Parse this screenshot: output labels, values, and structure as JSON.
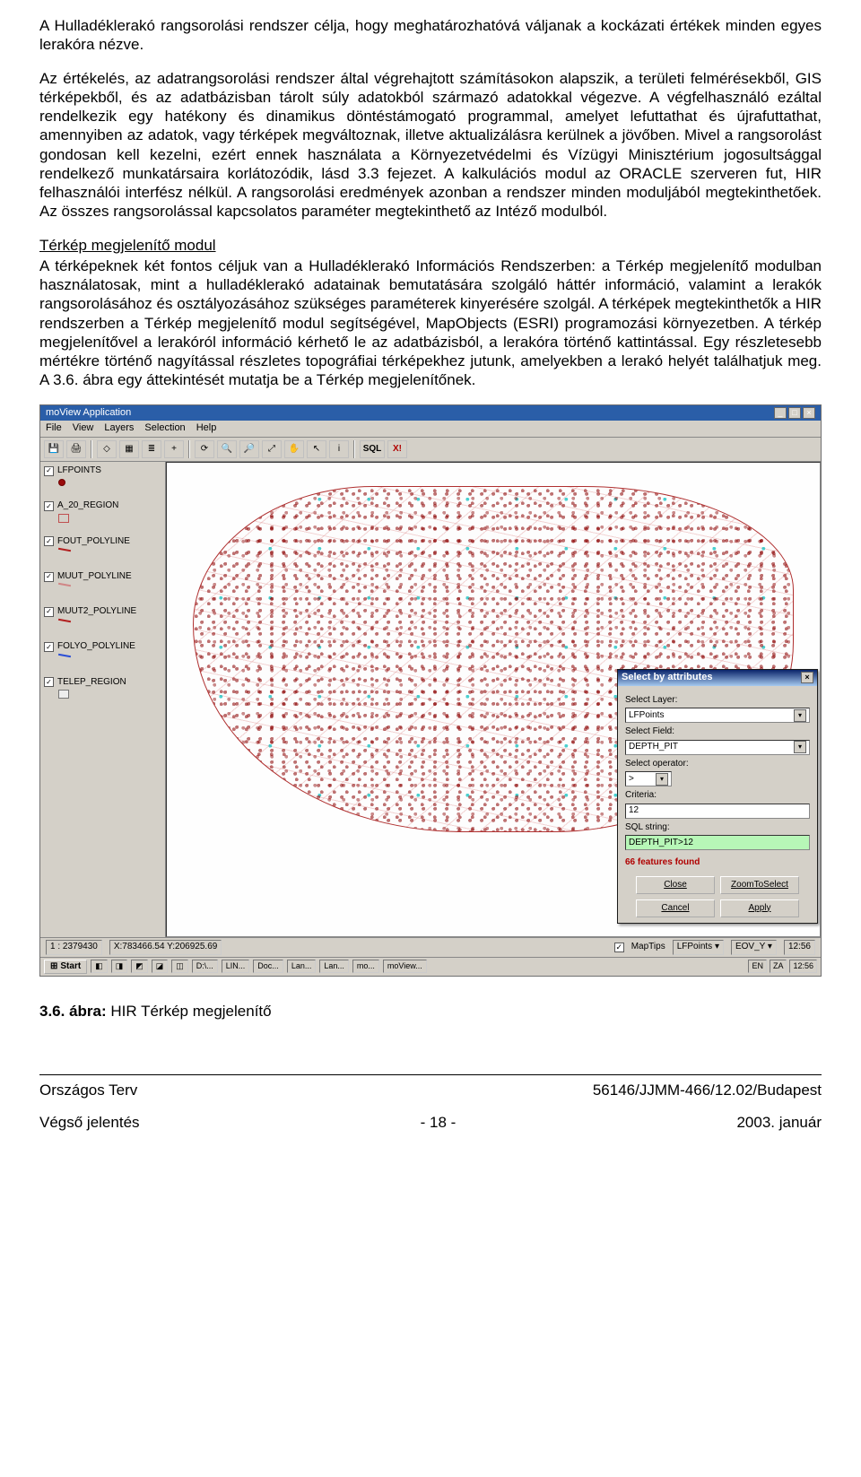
{
  "paragraph1": "A Hulladéklerakó rangsorolási rendszer célja, hogy meghatározhatóvá váljanak a kockázati értékek minden egyes lerakóra nézve.",
  "paragraph2": "Az értékelés, az adatrangsorolási rendszer által végrehajtott számításokon alapszik, a területi felmérésekből, GIS térképekből, és az adatbázisban tárolt súly adatokból származó adatokkal végezve. A végfelhasználó ezáltal rendelkezik egy hatékony és dinamikus döntéstámogató programmal, amelyet lefuttathat és újrafuttathat, amennyiben az adatok, vagy térképek megváltoznak, illetve aktualizálásra kerülnek a jövőben. Mivel a rangsorolást gondosan kell kezelni, ezért ennek használata a Környezetvédelmi és Vízügyi Minisztérium jogosultsággal rendelkező munkatársaira korlátozódik, lásd 3.3 fejezet. A kalkulációs modul az ORACLE szerveren fut, HIR felhasználói interfész nélkül. A rangsorolási eredmények azonban a rendszer minden moduljából megtekinthetőek. Az összes rangsorolással kapcsolatos paraméter megtekinthető az Intéző modulból.",
  "section_heading": "Térkép megjelenítő modul",
  "paragraph3": "A térképeknek két fontos céljuk van a Hulladéklerakó Információs Rendszerben: a Térkép megjelenítő modulban használatosak, mint a hulladéklerakó adatainak bemutatására szolgáló háttér információ, valamint a lerakók rangsorolásához és osztályozásához szükséges paraméterek kinyerésére szolgál. A térképek megtekinthetők a HIR rendszerben a Térkép megjelenítő modul segítségével, MapObjects (ESRI) programozási környezetben. A térkép megjelenítővel a lerakóról információ kérhető le az adatbázisból, a lerakóra történő kattintással. Egy részletesebb mértékre történő nagyítással részletes topográfiai térképekhez jutunk, amelyekben a lerakó helyét találhatjuk meg. A 3.6. ábra egy áttekintését mutatja be a Térkép megjelenítőnek.",
  "app": {
    "title": "moView Application",
    "menu": [
      "File",
      "View",
      "Layers",
      "Selection",
      "Help"
    ],
    "toolbar_icons": [
      "save-icon",
      "print-icon",
      "identify-icon",
      "select-icon",
      "layers-icon",
      "add-icon",
      "refresh-icon",
      "zoom-in-icon",
      "zoom-out-icon",
      "zoom-extent-icon",
      "pan-icon",
      "pointer-icon",
      "info-icon",
      "sql-icon",
      "clear-selection-icon"
    ],
    "toolbar_labels": [
      "",
      "",
      "",
      "",
      "",
      "+",
      "",
      "",
      "",
      "",
      "",
      "",
      "i",
      "SQL",
      "X!"
    ],
    "layers": [
      {
        "name": "LFPOINTS",
        "sym": "red-dot"
      },
      {
        "name": "A_20_REGION",
        "sym": "red-box"
      },
      {
        "name": "FOUT_POLYLINE",
        "sym": "red-line"
      },
      {
        "name": "MUUT_POLYLINE",
        "sym": "pink-line"
      },
      {
        "name": "MUUT2_POLYLINE",
        "sym": "red-line"
      },
      {
        "name": "FOLYO_POLYLINE",
        "sym": "blue-line"
      },
      {
        "name": "TELEP_REGION",
        "sym": "gray-box"
      }
    ],
    "dialog": {
      "title": "Select by attributes",
      "select_layer_label": "Select Layer:",
      "select_layer_value": "LFPoints",
      "select_field_label": "Select Field:",
      "select_field_value": "DEPTH_PIT",
      "operator_label": "Select operator:",
      "operator_value": ">",
      "criteria_label": "Criteria:",
      "criteria_value": "12",
      "sql_label": "SQL string:",
      "sql_value": "DEPTH_PIT>12",
      "found": "66 features found",
      "btn_close": "Close",
      "btn_zoom": "ZoomToSelect",
      "btn_cancel": "Cancel",
      "btn_apply": "Apply"
    },
    "status": {
      "scale": "1 : 2379430",
      "coords": "X:783466.54 Y:206925.69",
      "maptips_label": "MapTips",
      "maptips_layer": "LFPoints",
      "field": "EOV_Y",
      "time": "12:56"
    },
    "taskbar": {
      "start": "Start",
      "items": [
        "D:\\...",
        "LIN...",
        "Doc...",
        "Lan...",
        "Lan...",
        "mo...",
        "moView..."
      ],
      "tray": [
        "EN",
        "ZA",
        "12:56"
      ]
    }
  },
  "figure_caption_bold": "3.6. ábra:",
  "figure_caption_rest": " HIR Térkép megjelenítő",
  "footer": {
    "left1": "Országos Terv",
    "right1": "56146/JJMM-466/12.02/Budapest",
    "left2": "Végső jelentés",
    "center2": "- 18 -",
    "right2": "2003. január"
  }
}
